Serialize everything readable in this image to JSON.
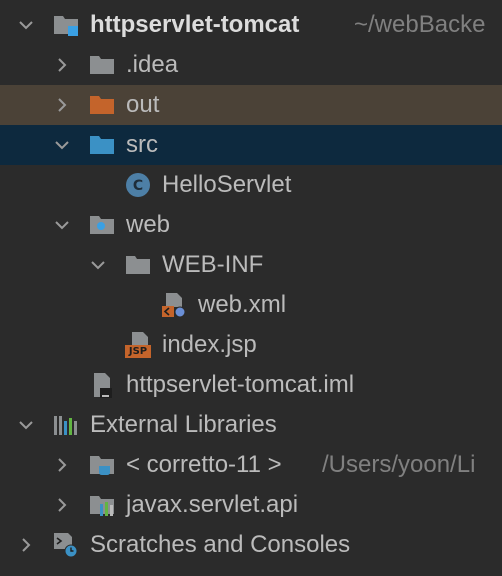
{
  "tree": {
    "project_root": {
      "name": "httpservlet-tomcat",
      "path": "~/webBacke"
    },
    "idea": {
      "name": ".idea"
    },
    "out": {
      "name": "out"
    },
    "src": {
      "name": "src"
    },
    "hello_servlet": {
      "name": "HelloServlet"
    },
    "web": {
      "name": "web"
    },
    "web_inf": {
      "name": "WEB-INF"
    },
    "web_xml": {
      "name": "web.xml"
    },
    "index_jsp": {
      "name": "index.jsp",
      "badge": "JSP"
    },
    "iml": {
      "name": "httpservlet-tomcat.iml"
    },
    "external_libraries": {
      "name": "External Libraries"
    },
    "jdk": {
      "name": "< corretto-11 >",
      "path": "/Users/yoon/Li"
    },
    "servlet_api": {
      "name": "javax.servlet.api"
    },
    "scratches": {
      "name": "Scratches and Consoles"
    }
  },
  "colors": {
    "background": "#2b2b2b",
    "selected_row": "#0d293e",
    "excluded_row": "#4b4237",
    "folder_gray": "#8c8f91",
    "folder_blue": "#3b91c5",
    "folder_orange": "#c4642b",
    "java_class": "#6aa3d4",
    "text": "#bbbbbb"
  }
}
